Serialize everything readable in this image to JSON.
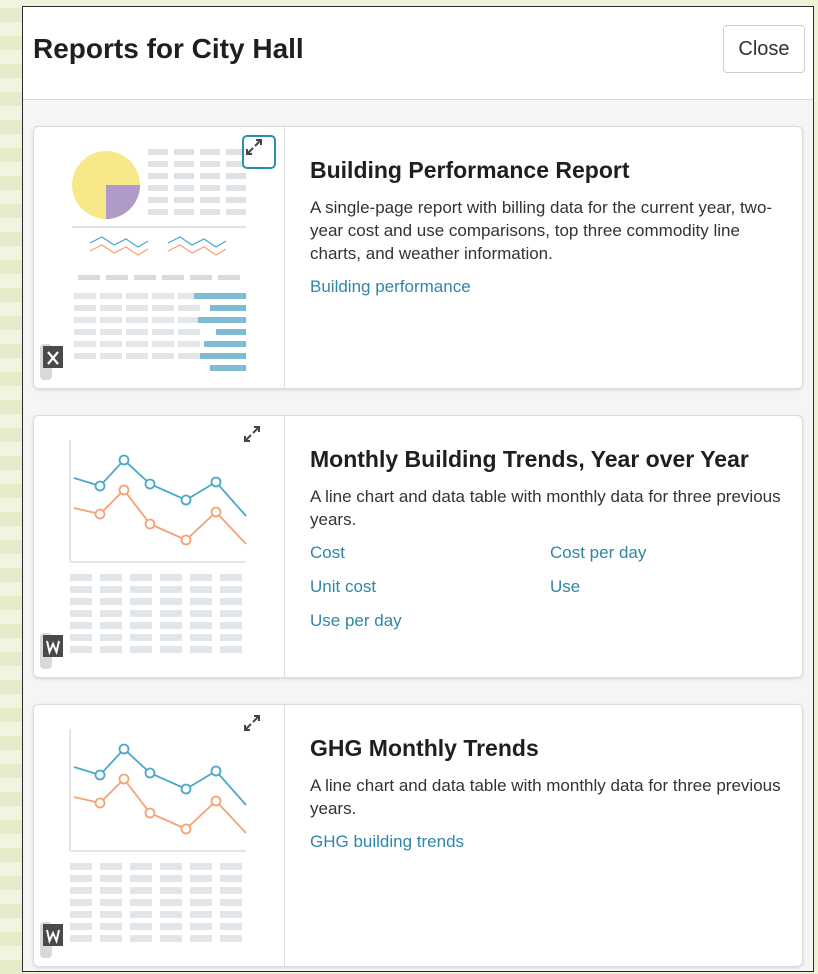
{
  "modal": {
    "title": "Reports for City Hall",
    "close_label": "Close"
  },
  "colors": {
    "link": "#2f86a8",
    "focus": "#2a8fb0",
    "trend_blue": "#4aa8c8",
    "trend_orange": "#f5a274",
    "pie_yellow": "#f7e98a",
    "pie_purple": "#b09ac8"
  },
  "reports": [
    {
      "title": "Building Performance Report",
      "description": "A single-page report with billing data for the current year, two-year cost and use comparisons, top three commodity line charts, and weather information.",
      "links": [
        "Building performance"
      ],
      "downloads": [
        "pdf-icon",
        "excel-icon"
      ]
    },
    {
      "title": "Monthly Building Trends, Year over Year",
      "description": "A line chart and data table with monthly data for three previous years.",
      "links": [
        "Cost",
        "Cost per day",
        "Unit cost",
        "Use",
        "Use per day"
      ],
      "downloads": [
        "pdf-icon",
        "excel-icon",
        "word-icon"
      ]
    },
    {
      "title": "GHG Monthly Trends",
      "description": "A line chart and data table with monthly data for three previous years.",
      "links": [
        "GHG building trends"
      ],
      "downloads": [
        "pdf-icon",
        "excel-icon",
        "word-icon"
      ]
    }
  ]
}
